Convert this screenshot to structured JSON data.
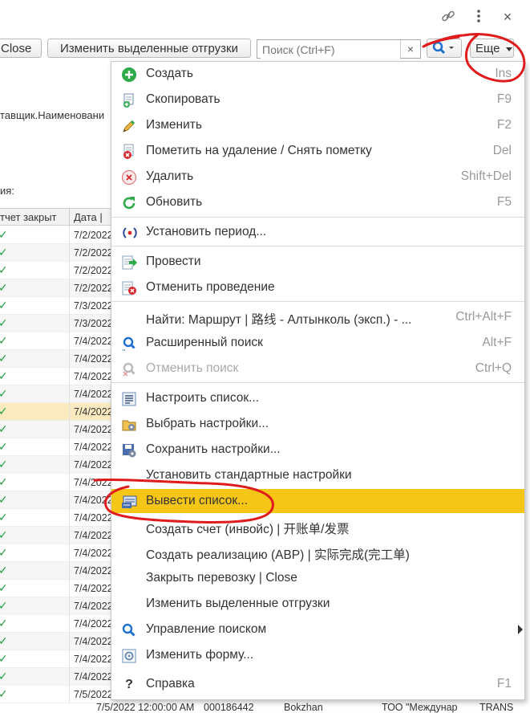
{
  "window": {
    "link_icon": "link-icon",
    "more_icon": "more-vertical-icon",
    "close_icon": "close-icon",
    "close_glyph": "×"
  },
  "toolbar": {
    "close_label": "Close",
    "edit_selected_label": "Изменить выделенные отгрузки",
    "search_placeholder": "Поиск (Ctrl+F)",
    "search_clear": "×",
    "search_button_icon": "search-icon",
    "more_label": "Еще"
  },
  "background": {
    "supplier_name_fragment": "тавщик.Наименовани",
    "section_label_fragment": "ия:",
    "columns": [
      "тчет закрыт",
      "Дата | "
    ],
    "rows": [
      {
        "checked": true,
        "date": "7/2/2022"
      },
      {
        "checked": true,
        "date": "7/2/2022"
      },
      {
        "checked": true,
        "date": "7/2/2022"
      },
      {
        "checked": true,
        "date": "7/2/2022"
      },
      {
        "checked": true,
        "date": "7/3/2022"
      },
      {
        "checked": true,
        "date": "7/3/2022"
      },
      {
        "checked": true,
        "date": "7/4/2022"
      },
      {
        "checked": true,
        "date": "7/4/2022"
      },
      {
        "checked": true,
        "date": "7/4/2022"
      },
      {
        "checked": true,
        "date": "7/4/2022"
      },
      {
        "checked": true,
        "date": "7/4/2022"
      },
      {
        "checked": true,
        "date": "7/4/2022"
      },
      {
        "checked": true,
        "date": "7/4/2022"
      },
      {
        "checked": true,
        "date": "7/4/2022"
      },
      {
        "checked": true,
        "date": "7/4/2022"
      },
      {
        "checked": true,
        "date": "7/4/2022"
      },
      {
        "checked": true,
        "date": "7/4/2022"
      },
      {
        "checked": true,
        "date": "7/4/2022"
      },
      {
        "checked": true,
        "date": "7/4/2022"
      },
      {
        "checked": true,
        "date": "7/4/2022"
      },
      {
        "checked": true,
        "date": "7/4/2022"
      },
      {
        "checked": true,
        "date": "7/4/2022"
      },
      {
        "checked": true,
        "date": "7/4/2022"
      },
      {
        "checked": true,
        "date": "7/4/2022"
      },
      {
        "checked": true,
        "date": "7/4/2022"
      },
      {
        "checked": true,
        "date": "7/4/2022"
      },
      {
        "checked": true,
        "date": "7/5/2022"
      }
    ],
    "highlighted_row_index": 10,
    "bottom_row": {
      "datetime": "7/5/2022 12:00:00 AM",
      "number": "000186442",
      "name": "Bokzhan",
      "org": "ТОО \"Междунар",
      "trans": "TRANS"
    }
  },
  "menu": {
    "items": [
      {
        "label": "Создать",
        "shortcut": "Ins",
        "icon": "plus-circle-icon"
      },
      {
        "label": "Скопировать",
        "shortcut": "F9",
        "icon": "copy-icon"
      },
      {
        "label": "Изменить",
        "shortcut": "F2",
        "icon": "pencil-icon"
      },
      {
        "label": "Пометить на удаление / Снять пометку",
        "shortcut": "Del",
        "icon": "mark-delete-icon"
      },
      {
        "label": "Удалить",
        "shortcut": "Shift+Del",
        "icon": "delete-icon"
      },
      {
        "label": "Обновить",
        "shortcut": "F5",
        "icon": "refresh-icon"
      },
      {
        "label": "Установить период...",
        "shortcut": "",
        "icon": "period-icon"
      },
      {
        "label": "Провести",
        "shortcut": "",
        "icon": "post-icon"
      },
      {
        "label": "Отменить проведение",
        "shortcut": "",
        "icon": "unpost-icon"
      },
      {
        "label": "Найти: Маршрут | 路线  - Алтынколь (эксп.) - ...",
        "shortcut": "Ctrl+Alt+F",
        "icon": ""
      },
      {
        "label": "Расширенный поиск",
        "shortcut": "Alt+F",
        "icon": "advanced-search-icon"
      },
      {
        "label": "Отменить поиск",
        "shortcut": "Ctrl+Q",
        "icon": "cancel-search-icon"
      },
      {
        "label": "Настроить список...",
        "shortcut": "",
        "icon": "configure-list-icon"
      },
      {
        "label": "Выбрать настройки...",
        "shortcut": "",
        "icon": "select-settings-icon"
      },
      {
        "label": "Сохранить настройки...",
        "shortcut": "",
        "icon": "save-settings-icon"
      },
      {
        "label": "Установить стандартные настройки",
        "shortcut": "",
        "icon": ""
      },
      {
        "label": "Вывести список...",
        "shortcut": "",
        "icon": "export-list-icon"
      },
      {
        "label": "Создать счет (инвойс) | 开账单/发票",
        "shortcut": "",
        "icon": ""
      },
      {
        "label": "Создать реализацию (АВР) | 实际完成(完工单)",
        "shortcut": "",
        "icon": ""
      },
      {
        "label": "Закрыть перевозку | Close",
        "shortcut": "",
        "icon": ""
      },
      {
        "label": "Изменить выделенные отгрузки",
        "shortcut": "",
        "icon": ""
      },
      {
        "label": "Управление поиском",
        "shortcut": "",
        "icon": "search-icon"
      },
      {
        "label": "Изменить форму...",
        "shortcut": "",
        "icon": "form-settings-icon"
      },
      {
        "label": "Справка",
        "shortcut": "F1",
        "icon": "help-icon",
        "icon_glyph": "?"
      }
    ]
  },
  "colors": {
    "highlight": "#f5c518",
    "annotation": "#e01b1b",
    "check_green": "#1f9e3c"
  }
}
